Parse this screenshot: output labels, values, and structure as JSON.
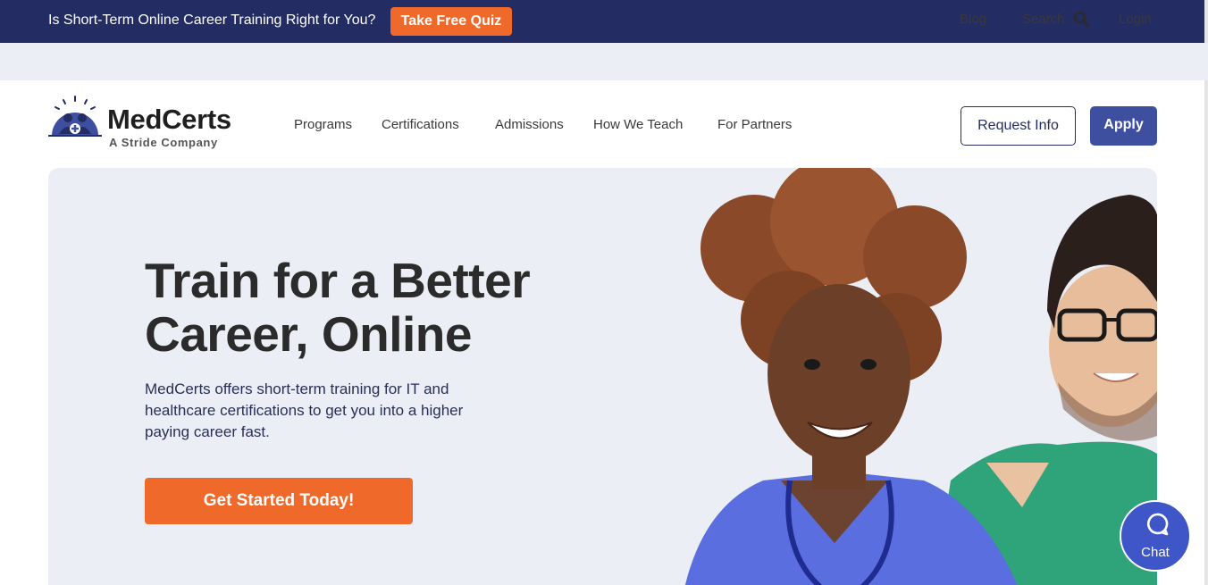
{
  "promo": {
    "text": "Is Short-Term Online Career Training Right for You?",
    "button": "Take Free Quiz"
  },
  "utility": {
    "blog": "Blog",
    "search": "Search",
    "login": "Login"
  },
  "logo": {
    "name": "MedCerts",
    "tagline": "A Stride Company"
  },
  "nav": {
    "items": [
      "Programs",
      "Certifications",
      "Admissions",
      "How We Teach",
      "For Partners"
    ]
  },
  "header_actions": {
    "request_info": "Request Info",
    "apply": "Apply"
  },
  "hero": {
    "title_lines": [
      "Train for a Better",
      "Career, Online"
    ],
    "subtitle_lines": [
      "MedCerts offers short-term training for IT and",
      "healthcare certifications to get you into a higher",
      "paying career fast."
    ],
    "cta": "Get Started Today!"
  },
  "chat": {
    "label": "Chat"
  },
  "colors": {
    "navy": "#232c63",
    "orange": "#ef6a2a",
    "apply_blue": "#3e4fa0",
    "hero_bg": "#eceef6",
    "chat_blue": "#3e56c8"
  },
  "icons": [
    "search-icon",
    "chat-bubble-icon",
    "medcerts-logo-icon"
  ]
}
